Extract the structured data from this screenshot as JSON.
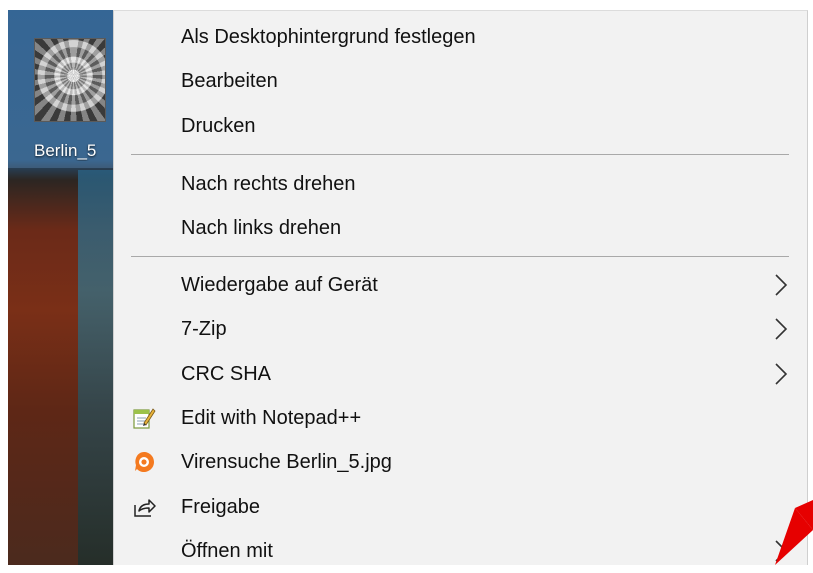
{
  "desktop": {
    "file_label": "Berlin_5"
  },
  "menu": {
    "items": [
      {
        "label": "Als Desktophintergrund festlegen",
        "icon": "",
        "submenu": false
      },
      {
        "label": "Bearbeiten",
        "icon": "",
        "submenu": false
      },
      {
        "label": "Drucken",
        "icon": "",
        "submenu": false
      },
      {
        "label": "Nach rechts drehen",
        "icon": "",
        "submenu": false
      },
      {
        "label": "Nach links drehen",
        "icon": "",
        "submenu": false
      },
      {
        "label": "Wiedergabe auf Gerät",
        "icon": "",
        "submenu": true
      },
      {
        "label": "7-Zip",
        "icon": "",
        "submenu": true
      },
      {
        "label": "CRC SHA",
        "icon": "",
        "submenu": true
      },
      {
        "label": "Edit with Notepad++",
        "icon": "notepad-plus-plus-icon",
        "submenu": false
      },
      {
        "label": "Virensuche Berlin_5.jpg",
        "icon": "avast-icon",
        "submenu": false
      },
      {
        "label": "Freigabe",
        "icon": "share-icon",
        "submenu": false
      },
      {
        "label": "Öffnen mit",
        "icon": "",
        "submenu": true
      }
    ]
  },
  "colors": {
    "menu_background": "#f2f2f2",
    "separator": "#a9a9a9",
    "avast_orange": "#f47a20",
    "annotation_red": "#e60000"
  }
}
